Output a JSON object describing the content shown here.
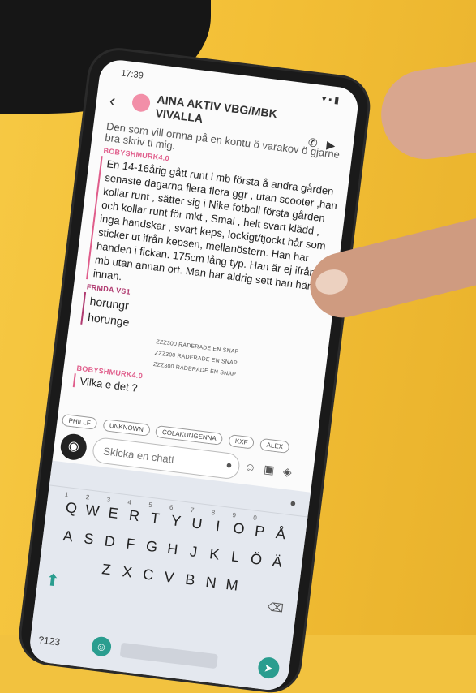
{
  "status": {
    "time": "17:39"
  },
  "header": {
    "title_line1": "AINA AKTIV VBG/MBK",
    "title_line2": "VIVALLA"
  },
  "messages": {
    "prev_text_1": "Den som vill ornna på en kontu ö varakov ö gjarne",
    "prev_text_2": "bra skriv ti mig.",
    "sender_1": "BOBYSHMURK4.0",
    "body_1": "En 14-16årig gått runt i mb första å andra gården senaste dagarna flera flera ggr , utan scooter ,han kollar runt , sätter sig i Nike fotboll första gården och kollar runt för mkt , Smal , helt svart klädd , inga handskar , svart keps, lockigt/tjockt hår som sticker ut ifrån kepsen, mellanöstern. Han har handen i fickan. 175cm lång typ. Han är ej ifrån mb utan annan ort. Man har aldrig sett han här innan.",
    "sender_2": "FRMDA VS1",
    "body_2a": "horungr",
    "body_2b": "horunge",
    "system_1": "ZZZ300 RADERADE EN SNAP",
    "system_2": "ZZZ300 RADERADE EN SNAP",
    "system_3": "ZZZ300 RADERADE EN SNAP",
    "sender_3": "BOBYSHMURK4.0",
    "body_3": "Vilka e det ?"
  },
  "chips": [
    "PHILLF",
    "UNKNOWN",
    "COLAKUNGENNA",
    "KXF",
    "ALEX"
  ],
  "input": {
    "placeholder": "Skicka en chatt"
  },
  "keyboard": {
    "row1": [
      "Q",
      "W",
      "E",
      "R",
      "T",
      "Y",
      "U",
      "I",
      "O",
      "P",
      "Å"
    ],
    "row1_nums": [
      "1",
      "2",
      "3",
      "4",
      "5",
      "6",
      "7",
      "8",
      "9",
      "0",
      ""
    ],
    "row2": [
      "A",
      "S",
      "D",
      "F",
      "G",
      "H",
      "J",
      "K",
      "L",
      "Ö",
      "Ä"
    ],
    "row3": [
      "Z",
      "X",
      "C",
      "V",
      "B",
      "N",
      "M"
    ],
    "num_label": "?123"
  },
  "colors": {
    "accent_pink": "#e05d8b",
    "keyboard_accent": "#2a9d8f",
    "table": "#f2c23f"
  }
}
